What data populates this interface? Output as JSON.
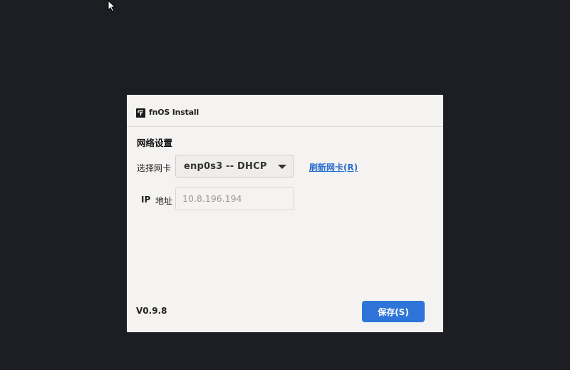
{
  "window": {
    "title": "fnOS Install",
    "icon": "fnos-logo-icon"
  },
  "network": {
    "section_title": "网络设置",
    "nic_label": "选择网卡",
    "nic_selected": "enp0s3 -- DHCP",
    "refresh_label": "刷新网卡(R)",
    "ip_label_en": "IP",
    "ip_label_zh": "地址",
    "ip_placeholder": "10.8.196.194"
  },
  "footer": {
    "version": "V0.9.8",
    "save_label": "保存(S)"
  },
  "colors": {
    "background": "#1c1e23",
    "dialog": "#f5f3f1",
    "accent": "#2e74d9",
    "link": "#2b6fd0"
  }
}
